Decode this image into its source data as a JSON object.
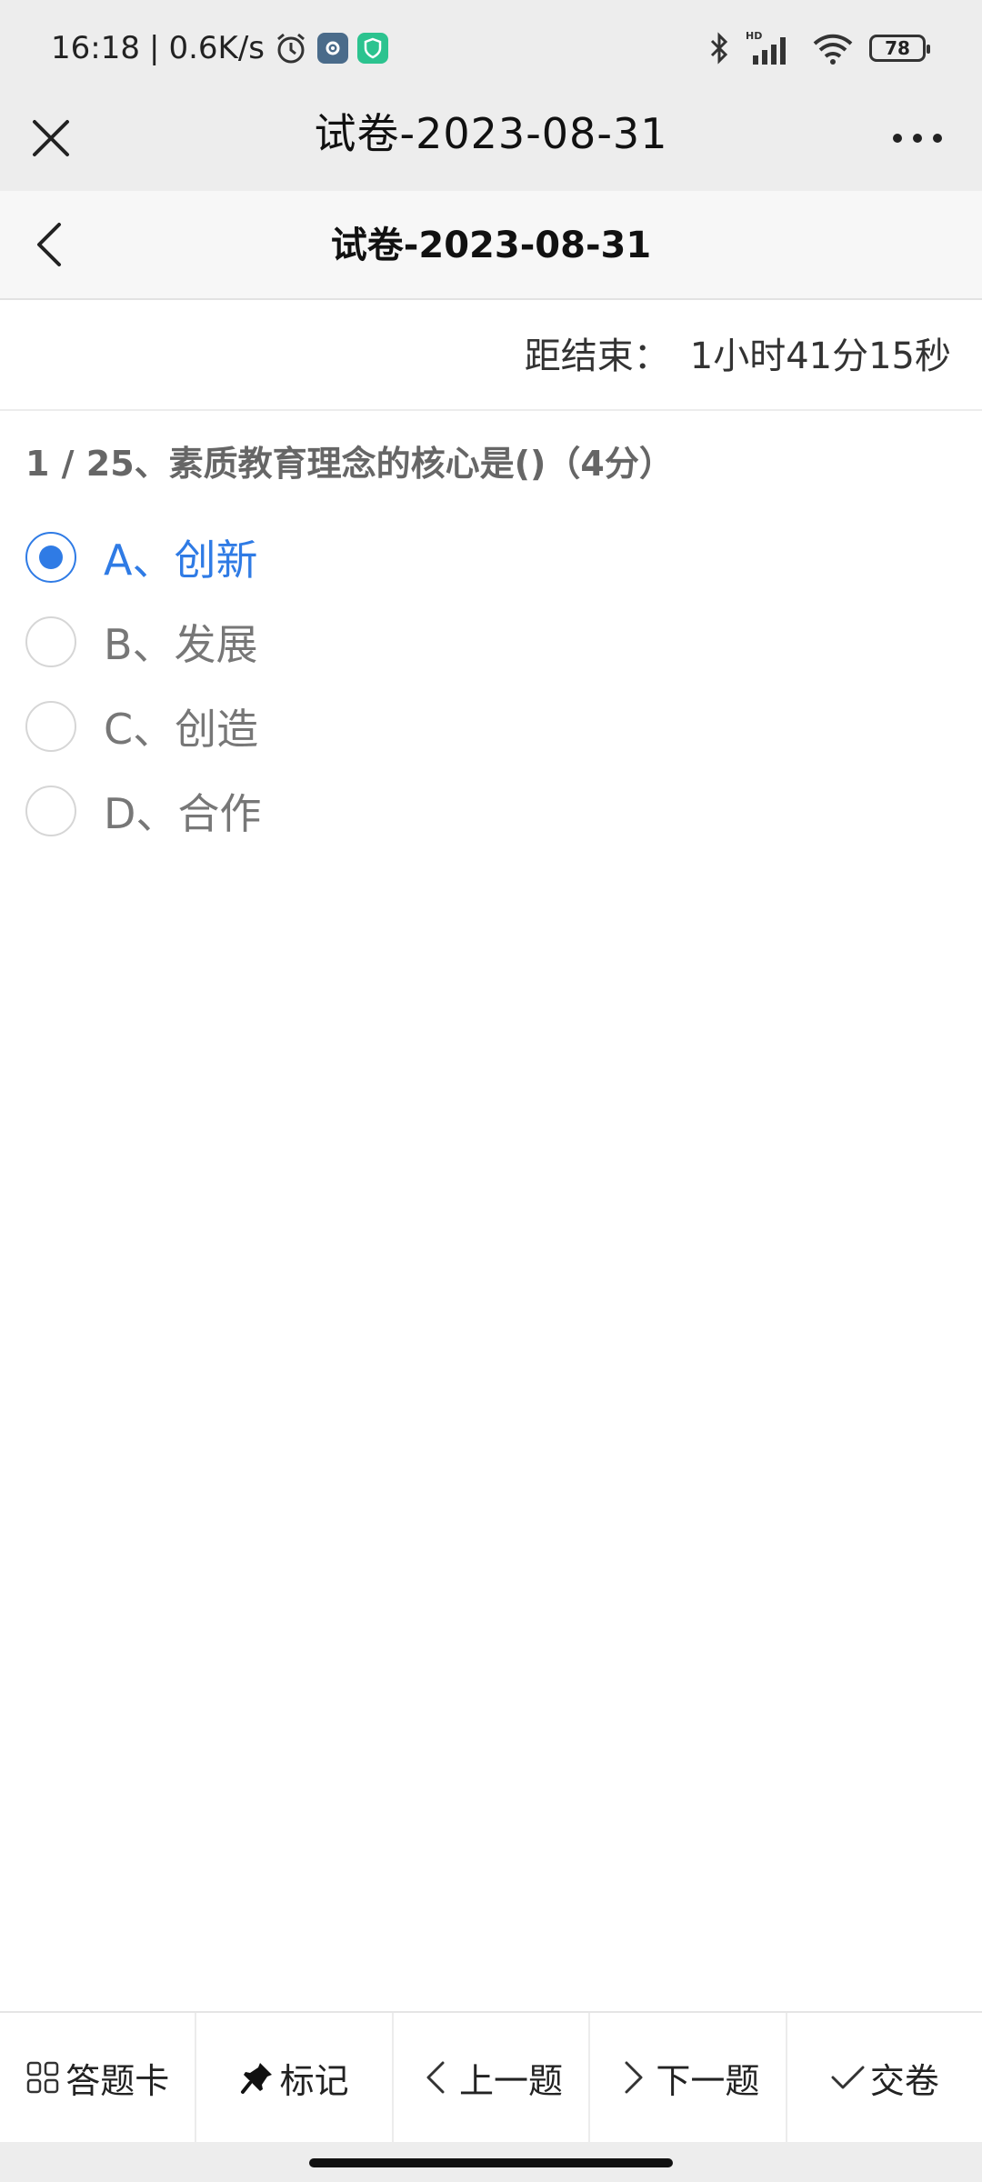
{
  "status_bar": {
    "time": "16:18",
    "separator": "|",
    "speed": "0.6K/s",
    "battery": "78",
    "icons": [
      "alarm-icon",
      "gear-app-icon",
      "shield-app-icon",
      "bluetooth-icon",
      "signal-icon",
      "wifi-icon",
      "battery-icon"
    ]
  },
  "wechat_bar": {
    "title": "试卷-2023-08-31",
    "close_icon": "close-icon",
    "more_icon": "more-icon"
  },
  "header": {
    "title": "试卷-2023-08-31",
    "back_icon": "chevron-left-icon"
  },
  "timer": {
    "label": "距结束：",
    "remaining": "1小时41分15秒"
  },
  "question": {
    "text": "1 / 25、素质教育理念的核心是()（4分）",
    "options": [
      {
        "label": "A、创新",
        "selected": true
      },
      {
        "label": "B、发展",
        "selected": false
      },
      {
        "label": "C、创造",
        "selected": false
      },
      {
        "label": "D、合作",
        "selected": false
      }
    ]
  },
  "toolbar": {
    "items": [
      {
        "label": "答题卡",
        "icon": "grid-icon"
      },
      {
        "label": "标记",
        "icon": "pin-icon"
      },
      {
        "label": "上一题",
        "icon": "chevron-left-icon"
      },
      {
        "label": "下一题",
        "icon": "chevron-right-icon"
      },
      {
        "label": "交卷",
        "icon": "check-icon"
      }
    ]
  },
  "colors": {
    "accent": "#2f7be5",
    "bar_bg": "#ededed",
    "header_bg": "#f7f7f7"
  }
}
